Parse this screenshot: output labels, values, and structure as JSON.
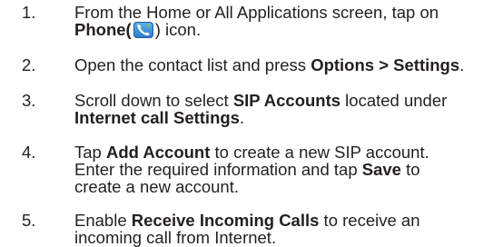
{
  "steps": [
    {
      "number": "1.",
      "line1_pre": "From the Home or All Applications screen, tap on",
      "line2_bold": "Phone",
      "line2_open": "(",
      "icon": "phone-icon",
      "line2_post": ") icon."
    },
    {
      "number": "2.",
      "pre": "Open the contact list and press ",
      "bold": "Options > Settings",
      "post": "."
    },
    {
      "number": "3.",
      "pre": "Scroll down to select ",
      "bold1": "SIP Accounts",
      "mid": " located under",
      "bold2": "Internet call Settings",
      "post": "."
    },
    {
      "number": "4.",
      "pre": "Tap ",
      "bold1": "Add Account",
      "mid": " to create a new SIP account.",
      "line2": "Enter the required information and tap ",
      "bold2": "Save",
      "line2_post": " to",
      "line3": "create a new account."
    },
    {
      "number": "5.",
      "pre": "Enable ",
      "bold": "Receive Incoming Calls",
      "post": " to receive an",
      "line2": "incoming call from Internet."
    }
  ],
  "colors": {
    "text": "#231f20",
    "icon_blue": "#2a7bc9",
    "icon_green": "#7cc242"
  }
}
